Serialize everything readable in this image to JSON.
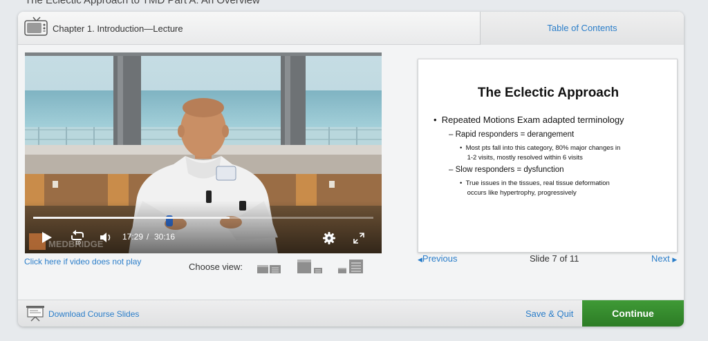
{
  "page": {
    "heading": "The Eclectic Approach to TMD Part A: An Overview"
  },
  "header": {
    "chapter_title": "Chapter 1. Introduction—Lecture",
    "toc_label": "Table of Contents"
  },
  "video": {
    "current_time": "17:29",
    "time_separator": "/",
    "duration": "30:16",
    "progress_fraction": 0.578,
    "watermark_text": "MEDBRIDGE",
    "help_link": "Click here if video does not play"
  },
  "view_chooser": {
    "label": "Choose view:"
  },
  "slide": {
    "title": "The Eclectic Approach",
    "bullet": "Repeated Motions Exam adapted terminology",
    "items": [
      {
        "label": "Rapid responders = derangement",
        "sub_line1": "Most pts fall into this category, 80% major changes in",
        "sub_line2": "1-2 visits, mostly resolved within 6 visits"
      },
      {
        "label": "Slow responders = dysfunction",
        "sub_line1": "True issues in the tissues, real tissue deformation",
        "sub_line2": "occurs like hypertrophy, progressively"
      }
    ]
  },
  "slide_nav": {
    "previous": "Previous",
    "counter": "Slide 7 of 11",
    "next": "Next"
  },
  "footer": {
    "download_label": "Download Course Slides",
    "save_quit_label": "Save & Quit",
    "continue_label": "Continue"
  },
  "colors": {
    "link": "#2a7dc9",
    "continue": "#2e7d26",
    "text": "#333333"
  },
  "icons": [
    "tv-icon",
    "play-icon",
    "rewind-10-icon",
    "volume-icon",
    "gear-icon",
    "fullscreen-icon",
    "presentation-icon",
    "caret-left-icon",
    "caret-right-icon"
  ]
}
